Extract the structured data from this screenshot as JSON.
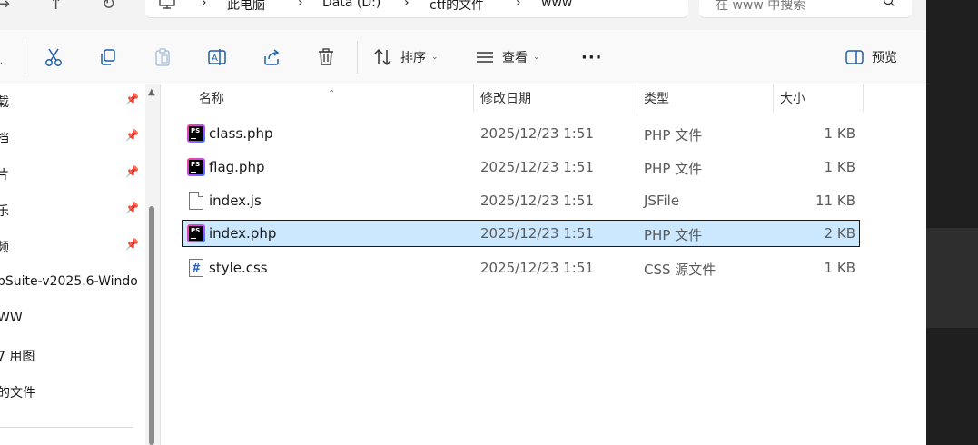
{
  "nav_buttons": {
    "back": "→",
    "up": "↑",
    "refresh": "↻"
  },
  "breadcrumb": [
    {
      "label": "此电脑"
    },
    {
      "label": "Data (D:)"
    },
    {
      "label": "ctf的文件"
    },
    {
      "label": "www"
    }
  ],
  "breadcrumb_sep": "›",
  "search": {
    "placeholder": "在 www 中搜索"
  },
  "toolbar": {
    "sort_label": "排序",
    "view_label": "查看",
    "more_label": "···",
    "preview_label": "预览"
  },
  "sidebar": {
    "items": [
      {
        "label": "载",
        "pinned": true
      },
      {
        "label": "档",
        "pinned": true
      },
      {
        "label": "片",
        "pinned": true
      },
      {
        "label": "乐",
        "pinned": true
      },
      {
        "label": "频",
        "pinned": true
      },
      {
        "label": "pSuite-v2025.6-Windo",
        "pinned": false
      },
      {
        "label": "WW",
        "pinned": false
      },
      {
        "label": "7 用图",
        "pinned": false
      },
      {
        "label": "的文件",
        "pinned": false
      }
    ],
    "pin_glyph": "📌"
  },
  "columns": {
    "name": "名称",
    "modified": "修改日期",
    "type": "类型",
    "size": "大小"
  },
  "files": [
    {
      "name": "class.php",
      "modified": "2025/12/23 1:51",
      "type": "PHP 文件",
      "size": "1 KB",
      "icon": "phpstorm-icon",
      "selected": false
    },
    {
      "name": "flag.php",
      "modified": "2025/12/23 1:51",
      "type": "PHP 文件",
      "size": "1 KB",
      "icon": "phpstorm-icon",
      "selected": false
    },
    {
      "name": "index.js",
      "modified": "2025/12/23 1:51",
      "type": "JSFile",
      "size": "11 KB",
      "icon": "file-icon",
      "selected": false
    },
    {
      "name": "index.php",
      "modified": "2025/12/23 1:51",
      "type": "PHP 文件",
      "size": "2 KB",
      "icon": "phpstorm-icon",
      "selected": true
    },
    {
      "name": "style.css",
      "modified": "2025/12/23 1:51",
      "type": "CSS 源文件",
      "size": "1 KB",
      "icon": "css-file-icon",
      "selected": false
    }
  ],
  "colors": {
    "selection": "#cce8ff",
    "accent": "#0067c0",
    "dark_strip": "#1f1f1f"
  }
}
